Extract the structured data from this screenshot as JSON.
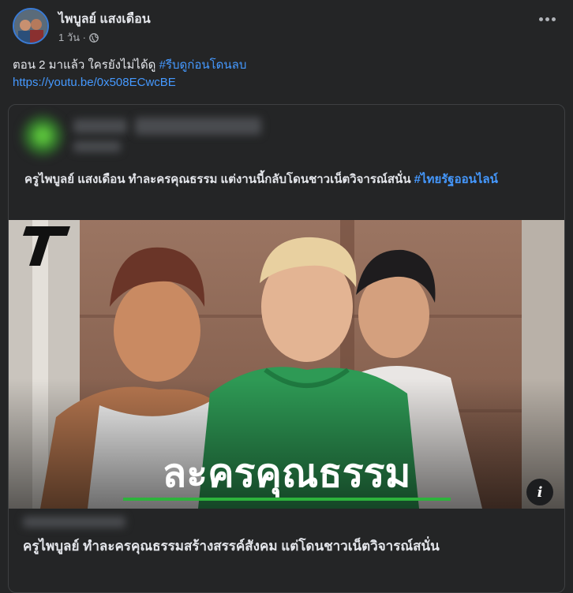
{
  "post": {
    "author": "ไพบูลย์ แสงเดือน",
    "time": "1 วัน ·",
    "caption_text": "ตอน 2 มาแล้ว ใครยังไม่ได้ดู",
    "caption_hashtag": "#รีบดูก่อนโดนลบ",
    "link": "https://youtu.be/0x508ECwcBE"
  },
  "shared": {
    "text": "ครูไพบูลย์ แสงเดือน ทำละครคุณธรรม แต่งานนี้กลับโดนชาวเน็ตวิจารณ์สนั่น",
    "hashtag": "#ไทยรัฐออนไลน์",
    "image_overlay_text": "ละครคุณธรรม",
    "logo_letter": "T",
    "info": "i",
    "headline": "ครูไพบูลย์ ทำละครคุณธรรมสร้างสรรค์สังคม แต่โดนชาวเน็ตวิจารณ์สนั่น"
  },
  "colors": {
    "background": "#242526",
    "text": "#e4e6eb",
    "secondary_text": "#b0b3b8",
    "link": "#4599ff",
    "overlay_underline": "#2db33c"
  },
  "icons": {
    "privacy": "globe-icon",
    "menu": "more-horizontal-icon",
    "info": "info-icon"
  }
}
